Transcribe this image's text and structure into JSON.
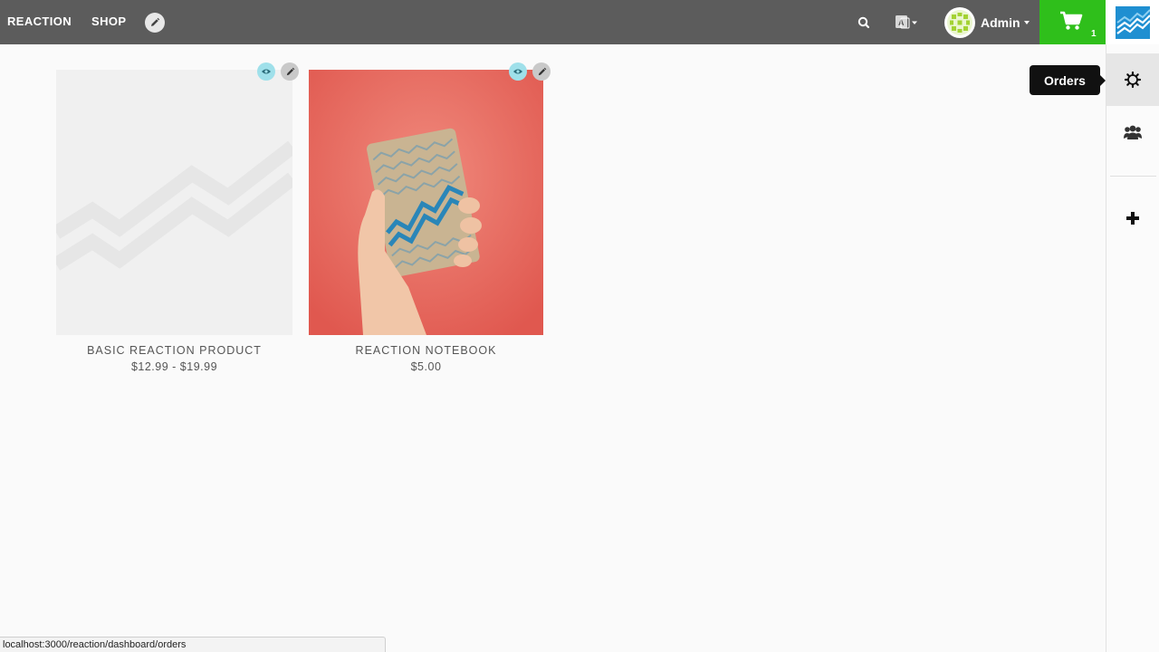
{
  "navbar": {
    "brand": "REACTION",
    "shop_link": "SHOP",
    "account_name": "Admin",
    "cart_count": "1"
  },
  "tooltip": {
    "label": "Orders"
  },
  "products": [
    {
      "title": "BASIC REACTION PRODUCT",
      "price": "$12.99 - $19.99",
      "image": "placeholder-image"
    },
    {
      "title": "REACTION NOTEBOOK",
      "price": "$5.00",
      "image": "notebook-photo"
    }
  ],
  "admin_panel": {
    "items": [
      {
        "icon": "gear-icon",
        "label": "Orders",
        "active": true
      },
      {
        "icon": "users-icon"
      },
      {
        "icon": "plus-icon"
      }
    ]
  },
  "statusbar": {
    "url": "localhost:3000/reaction/dashboard/orders"
  },
  "colors": {
    "navbar_bg": "#5c5c5c",
    "cart_bg": "#2fbf1b",
    "visibility_button": "#9fe0ea",
    "product_card_bg": "#f0f0f0",
    "notebook_bg": "#e86e63"
  }
}
